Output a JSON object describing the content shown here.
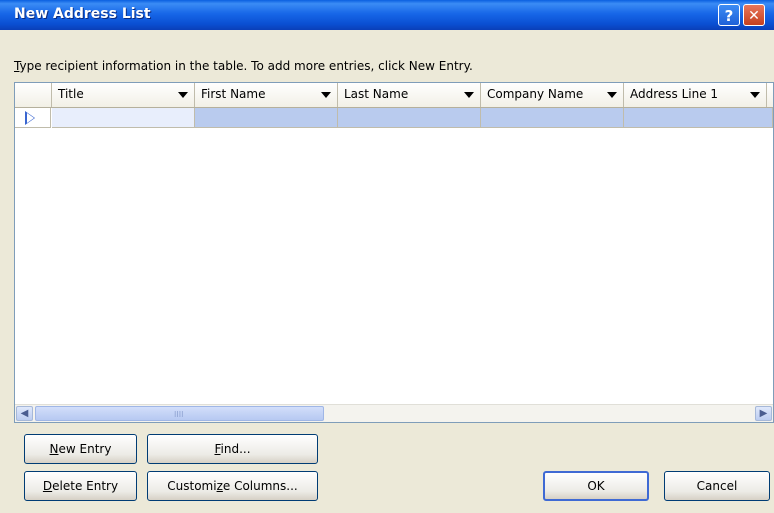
{
  "window": {
    "title": "New Address List",
    "help_glyph": "?",
    "close_glyph": "✕"
  },
  "instruction": {
    "underlined": "T",
    "rest": "ype recipient information in the table.  To add more entries, click New Entry."
  },
  "grid": {
    "columns": [
      {
        "label": "Title"
      },
      {
        "label": "First Name"
      },
      {
        "label": "Last Name"
      },
      {
        "label": "Company Name"
      },
      {
        "label": "Address Line 1"
      }
    ],
    "scroll_grip": "IIII"
  },
  "buttons": {
    "new_entry": {
      "u": "N",
      "rest": "ew Entry"
    },
    "find": {
      "u": "F",
      "rest": "ind..."
    },
    "delete_entry": {
      "u": "D",
      "rest": "elete Entry"
    },
    "customize_columns": {
      "pre": "Customi",
      "u": "z",
      "rest": "e Columns..."
    },
    "ok": "OK",
    "cancel": "Cancel"
  },
  "colors": {
    "title_bar": "#0a4fd2",
    "dialog_bg": "#ece9d8",
    "selected_row": "#b9cbee",
    "active_cell": "#e8eefc"
  }
}
